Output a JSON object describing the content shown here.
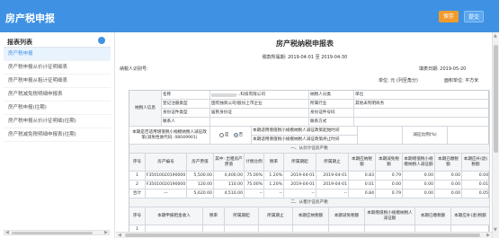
{
  "header": {
    "title": "房产税申报",
    "save_label": "保存",
    "submit_label": "提交"
  },
  "sidebar": {
    "heading": "报表列表",
    "items": [
      "房产税申报",
      "房产税申报从价计征明细表",
      "房产税申报从租计征明细表",
      "房产税减免税明细申报表",
      "房产税申报(往期)",
      "房产税申报从价计征明细(往期)",
      "房产税减免税明细申报表(往期)"
    ]
  },
  "form": {
    "title": "房产税纳税申报表",
    "period_label": "税款所属期:",
    "period_from": "2019-04-01",
    "period_sep": "至",
    "period_to": "2019-04-30",
    "taxpayer_id_label": "纳税人识别号:",
    "fill_date_label": "填表日期:",
    "fill_date": "2019-05-20",
    "unit_label": "单位: 元 (列至角分)",
    "area_label": "面积单位: 平方米"
  },
  "table": {
    "taxpayer_info": "纳税人信息",
    "name_label": "名称",
    "name_value": "...科技有限公司",
    "type_label": "纳税人分类",
    "type_value": "单位",
    "reg_type_label": "登记注册类型",
    "reg_type_value": "国有独资公司/股份上市企业",
    "industry_label": "所属行业",
    "industry_value": "其他未列明商务",
    "id_type_label": "身份证件类型",
    "id_type_value": "居民身份证",
    "id_no_label": "身份证件号码",
    "contact_label": "联系人",
    "phone_label": "联系方式",
    "relief_q": "本期是否适用增值税小规模纳税人减征政策(减免性质代码: 08049901)",
    "yes_label": "是",
    "no_label": "否",
    "relief_start": "本期适用增值税小规模纳税人减征政策起始时间",
    "relief_end": "本期适用增值税小规模纳税人减征政策终止时间",
    "relief_ratio": "减征比例(%)",
    "sec1": "一、从价计征房产税",
    "sec2": "二、从租计征房产税",
    "h1": [
      "序号",
      "房产编号",
      "房产原值",
      "其中: 出租房产原值",
      "计税比例",
      "税率",
      "所属期起",
      "所属期止",
      "本期应纳税额",
      "本期减免税额",
      "本期增值税小规模纳税人减征额",
      "本期已缴税额",
      "本期应补(退)税额"
    ],
    "rows1": [
      [
        "1",
        "F35010020190000",
        "5,500.00",
        "4,400.00",
        "75.00%",
        "1.20%",
        "2019-04-01",
        "2019-04-01",
        "0.83",
        "0.79",
        "0.00",
        "0.00",
        "0.04"
      ],
      [
        "2",
        "F35010020190000",
        "120.00",
        "110.00",
        "75.00%",
        "1.20%",
        "2019-04-01",
        "2019-04-01",
        "0.01",
        "0.00",
        "0.00",
        "0.00",
        "0.01"
      ],
      [
        "合计",
        "---",
        "5,620.00",
        "4,510.00",
        "--",
        "--",
        "--",
        "--",
        "0.84",
        "0.79",
        "0.00",
        "0.00",
        "0.05"
      ]
    ],
    "h2": [
      "序号",
      "本期申报租金收入",
      "税率",
      "所属期起",
      "所属期止",
      "本期应纳税额",
      "本期减免税额",
      "本期增值税小规模纳税人减征额",
      "本期已缴税额",
      "本期应补(退)税额"
    ],
    "rows2": [
      [
        "1",
        "",
        "",
        "",
        "",
        "",
        "",
        "",
        "",
        ""
      ],
      [
        "合计",
        "",
        "",
        "",
        "",
        "",
        "",
        "",
        "",
        ""
      ]
    ]
  }
}
